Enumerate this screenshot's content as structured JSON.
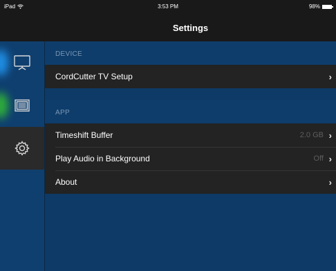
{
  "status_bar": {
    "device": "iPad",
    "time": "3:53 PM",
    "battery": "98%",
    "battery_level": 0.98
  },
  "nav": {
    "title": "Settings"
  },
  "sidebar": {
    "items": [
      {
        "icon": "tv-icon",
        "active": false,
        "glow_color": "#1f8fe6"
      },
      {
        "icon": "guide-icon",
        "active": false,
        "glow_color": "#2fae3a"
      },
      {
        "icon": "gear-icon",
        "active": true
      }
    ]
  },
  "device_section": {
    "header": "DEVICE",
    "rows": [
      {
        "label": "CordCutter TV Setup",
        "value": ""
      }
    ]
  },
  "app_section": {
    "header": "APP",
    "rows": [
      {
        "label": "Timeshift Buffer",
        "value": "2.0 GB"
      },
      {
        "label": "Play Audio in Background",
        "value": "Off"
      },
      {
        "label": "About",
        "value": ""
      }
    ]
  },
  "chevron": "›",
  "colors": {
    "background": "#0d3a66",
    "row": "#232323",
    "bar": "#191919",
    "header_text": "#7d97b5",
    "value_text": "#5e5e5e"
  }
}
